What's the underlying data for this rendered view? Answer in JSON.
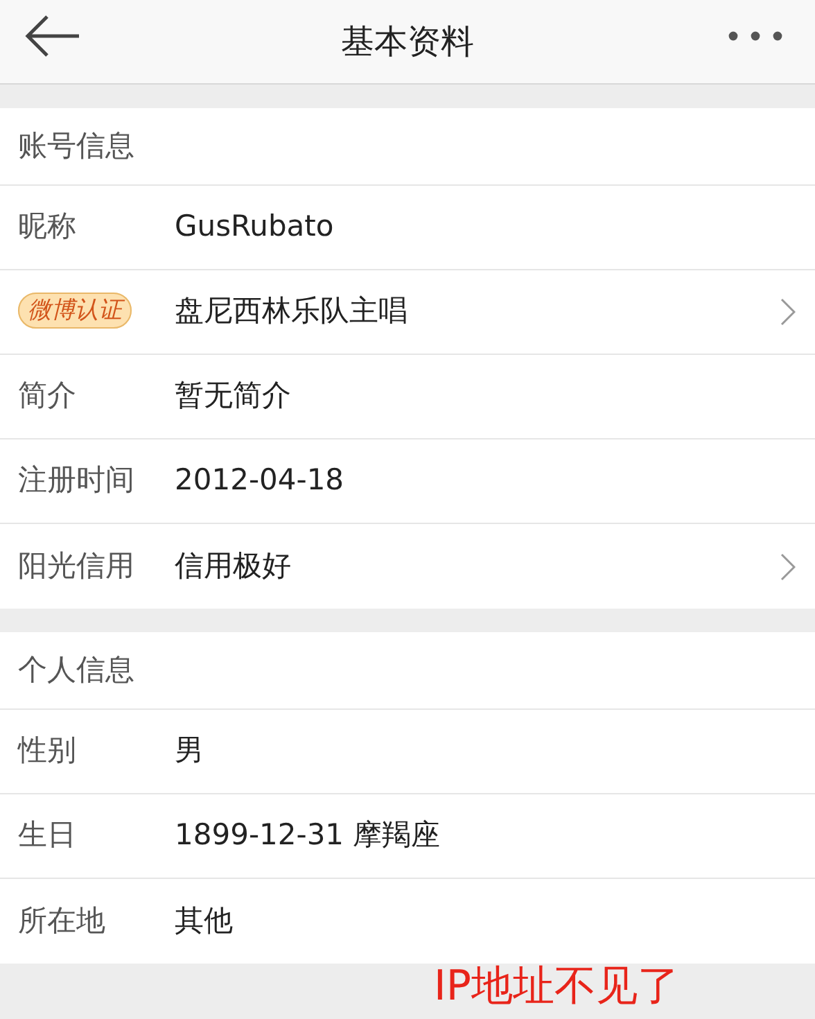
{
  "header": {
    "title": "基本资料"
  },
  "sections": [
    {
      "title": "账号信息",
      "rows": [
        {
          "label": "昵称",
          "kind": "text",
          "value": "GusRubato",
          "chevron": false
        },
        {
          "label": "微博认证",
          "kind": "badge",
          "value": "盘尼西林乐队主唱",
          "chevron": true
        },
        {
          "label": "简介",
          "kind": "text",
          "value": "暂无简介",
          "chevron": false
        },
        {
          "label": "注册时间",
          "kind": "text",
          "value": "2012-04-18",
          "chevron": false
        },
        {
          "label": "阳光信用",
          "kind": "text",
          "value": "信用极好",
          "chevron": true
        }
      ]
    },
    {
      "title": "个人信息",
      "rows": [
        {
          "label": "性别",
          "kind": "text",
          "value": "男",
          "chevron": false
        },
        {
          "label": "生日",
          "kind": "text",
          "value": "1899-12-31 摩羯座",
          "chevron": false
        },
        {
          "label": "所在地",
          "kind": "text",
          "value": "其他",
          "chevron": false
        }
      ]
    }
  ],
  "annotation": "IP地址不见了"
}
